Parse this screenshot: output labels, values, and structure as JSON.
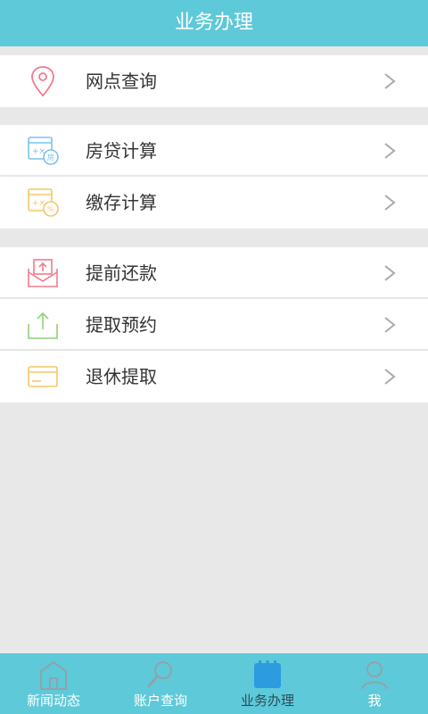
{
  "header": {
    "title": "业务办理"
  },
  "groups": [
    {
      "items": [
        {
          "label": "网点查询",
          "icon": "location-pin-icon",
          "color": "#f27b8e"
        }
      ]
    },
    {
      "items": [
        {
          "label": "房贷计算",
          "icon": "loan-calculator-icon",
          "color": "#7ac3e8"
        },
        {
          "label": "缴存计算",
          "icon": "deposit-calculator-icon",
          "color": "#f3c766"
        }
      ]
    },
    {
      "items": [
        {
          "label": "提前还款",
          "icon": "repayment-envelope-icon",
          "color": "#f27b8e"
        },
        {
          "label": "提取预约",
          "icon": "upload-tray-icon",
          "color": "#8fd07a"
        },
        {
          "label": "退休提取",
          "icon": "card-icon",
          "color": "#f3c766"
        }
      ]
    }
  ],
  "tabbar": {
    "tabs": [
      {
        "label": "新闻动态",
        "icon": "home-icon"
      },
      {
        "label": "账户查询",
        "icon": "search-icon"
      },
      {
        "label": "业务办理",
        "icon": "calendar-icon",
        "active": true
      },
      {
        "label": "我",
        "icon": "user-icon"
      }
    ]
  },
  "colors": {
    "accent": "#5ec9d8",
    "active_icon": "#2d9be0",
    "background": "#e8e8e8"
  }
}
